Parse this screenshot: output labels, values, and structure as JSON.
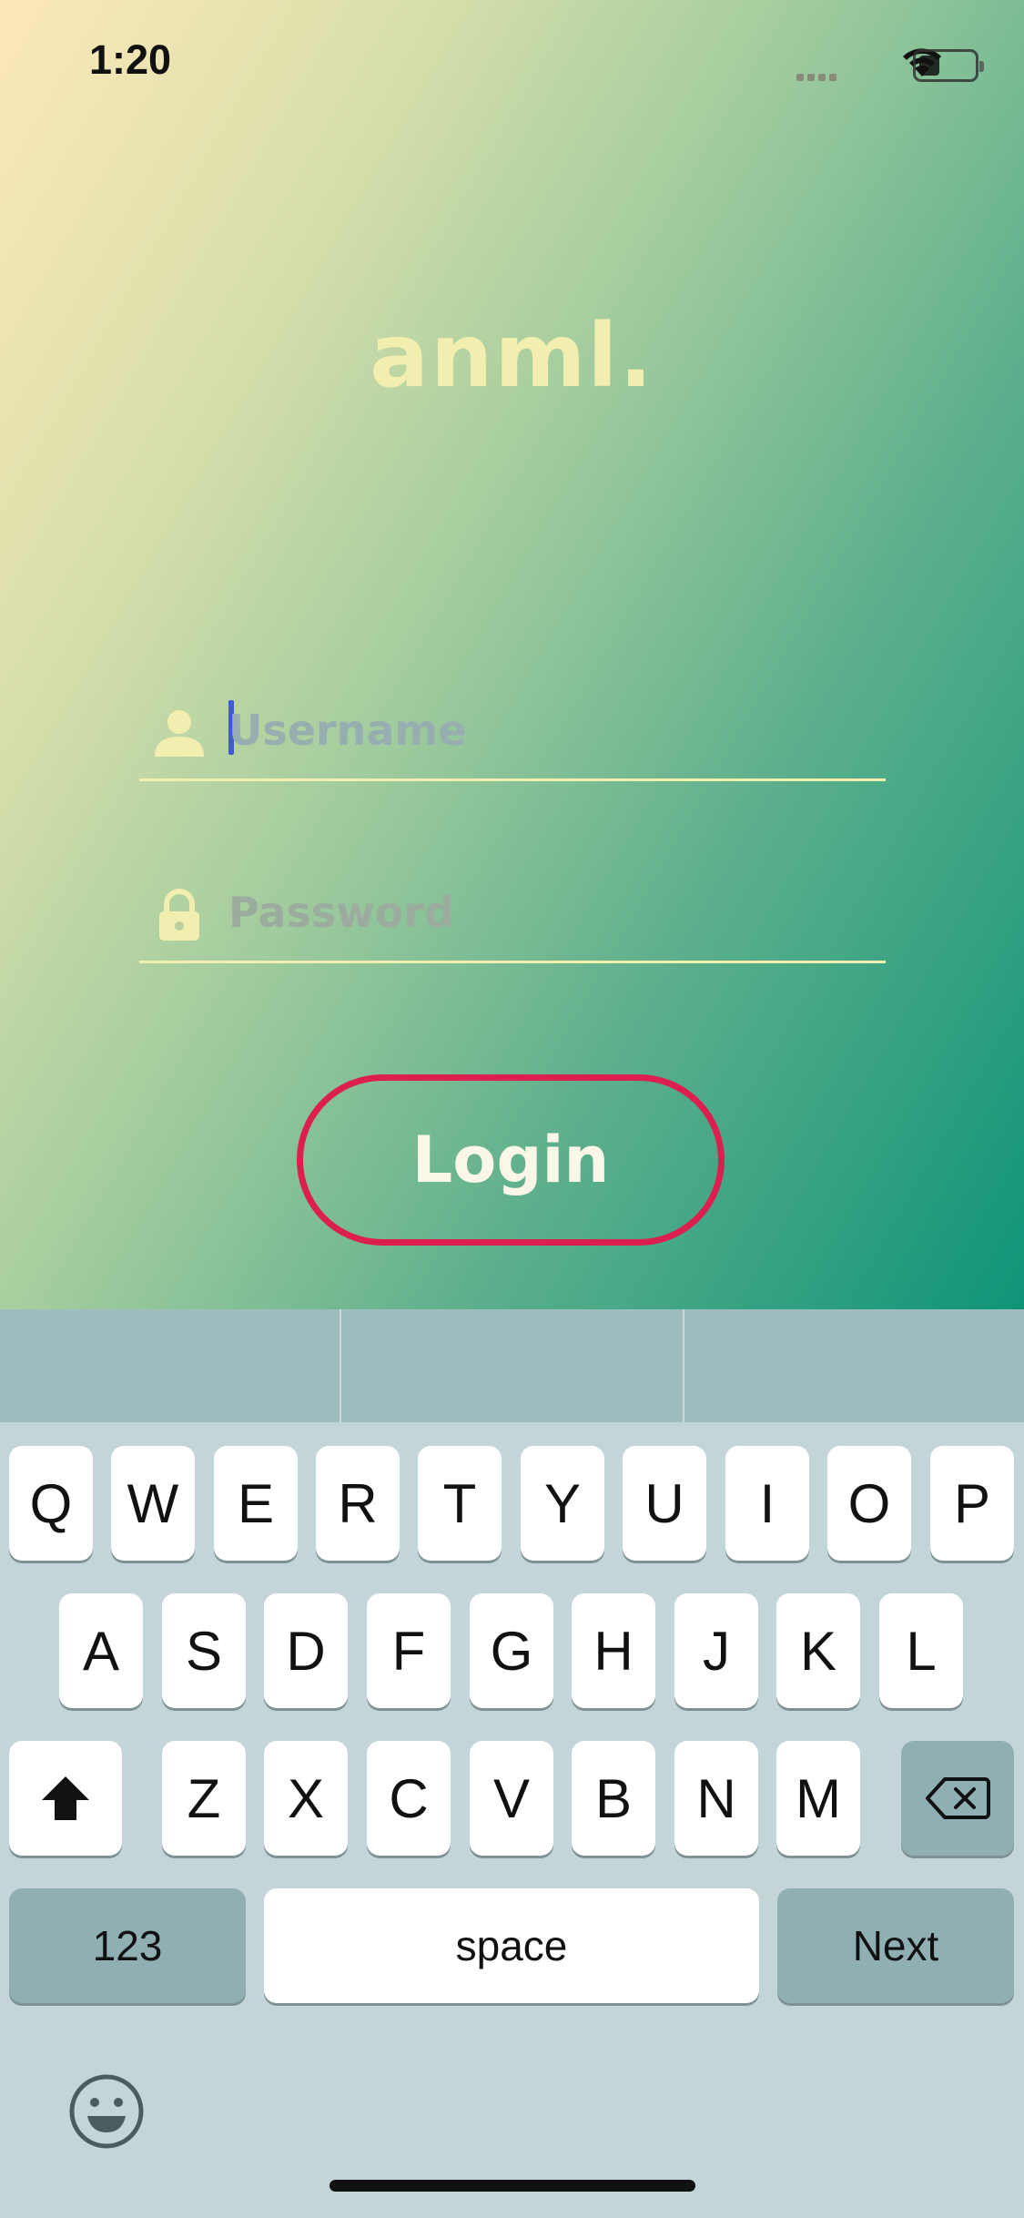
{
  "status_bar": {
    "time": "1:20"
  },
  "app": {
    "logo": "anml.",
    "username_placeholder": "Username",
    "password_placeholder": "Password",
    "login_label": "Login",
    "colors": {
      "accent_border": "#dc1f4f",
      "logo": "#f1eeaf",
      "gradient_start": "#fde9b8",
      "gradient_end": "#0f9478"
    }
  },
  "keyboard": {
    "row1": [
      "Q",
      "W",
      "E",
      "R",
      "T",
      "Y",
      "U",
      "I",
      "O",
      "P"
    ],
    "row2": [
      "A",
      "S",
      "D",
      "F",
      "G",
      "H",
      "J",
      "K",
      "L"
    ],
    "row3": [
      "Z",
      "X",
      "C",
      "V",
      "B",
      "N",
      "M"
    ],
    "numbers_label": "123",
    "space_label": "space",
    "return_label": "Next"
  }
}
